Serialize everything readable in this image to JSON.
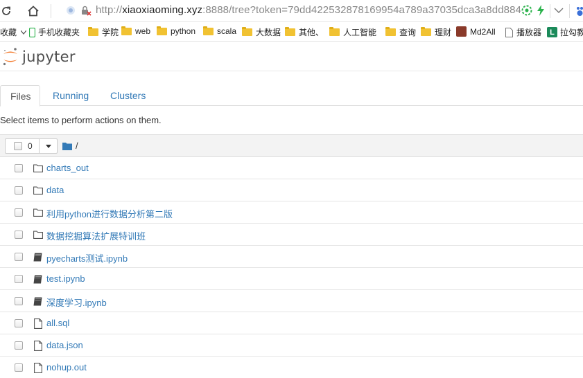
{
  "browser": {
    "url_protocol": "http://",
    "url_domain": "xiaoxiaoming.xyz",
    "url_rest": ":8888/tree?token=79dd422532878169954a789a37035dca3a8dd884"
  },
  "bookmarks": [
    {
      "label": "收藏",
      "icon": "none"
    },
    {
      "label": "手机收藏夹",
      "icon": "phone-icon"
    },
    {
      "label": "学院",
      "icon": "folder-icon"
    },
    {
      "label": "web",
      "icon": "folder-icon"
    },
    {
      "label": "python",
      "icon": "folder-icon"
    },
    {
      "label": "scala",
      "icon": "folder-icon"
    },
    {
      "label": "大数据",
      "icon": "folder-icon"
    },
    {
      "label": "其他、",
      "icon": "folder-icon"
    },
    {
      "label": "人工智能",
      "icon": "folder-icon"
    },
    {
      "label": "查询",
      "icon": "folder-icon"
    },
    {
      "label": "理财",
      "icon": "folder-icon"
    },
    {
      "label": "Md2All",
      "icon": "avatar-icon"
    },
    {
      "label": "播放器",
      "icon": "page-icon"
    },
    {
      "label": "拉勾教",
      "icon": "l-logo-icon"
    }
  ],
  "header": {
    "logo_text": "jupyter"
  },
  "tabs": [
    {
      "label": "Files",
      "active": true
    },
    {
      "label": "Running",
      "active": false
    },
    {
      "label": "Clusters",
      "active": false
    }
  ],
  "hint": "Select items to perform actions on them.",
  "list_header": {
    "selected_count": "0",
    "path": "/"
  },
  "items": [
    {
      "name": "charts_out",
      "type": "folder"
    },
    {
      "name": "data",
      "type": "folder"
    },
    {
      "name": "利用python进行数据分析第二版",
      "type": "folder"
    },
    {
      "name": "数据挖掘算法扩展特训班",
      "type": "folder"
    },
    {
      "name": "pyecharts测试.ipynb",
      "type": "notebook"
    },
    {
      "name": "test.ipynb",
      "type": "notebook"
    },
    {
      "name": "深度学习.ipynb",
      "type": "notebook"
    },
    {
      "name": "all.sql",
      "type": "file"
    },
    {
      "name": "data.json",
      "type": "file"
    },
    {
      "name": "nohup.out",
      "type": "file"
    }
  ],
  "colors": {
    "link": "#337ab7",
    "jupyter_orange": "#f37726",
    "folder": "#f1c232"
  }
}
